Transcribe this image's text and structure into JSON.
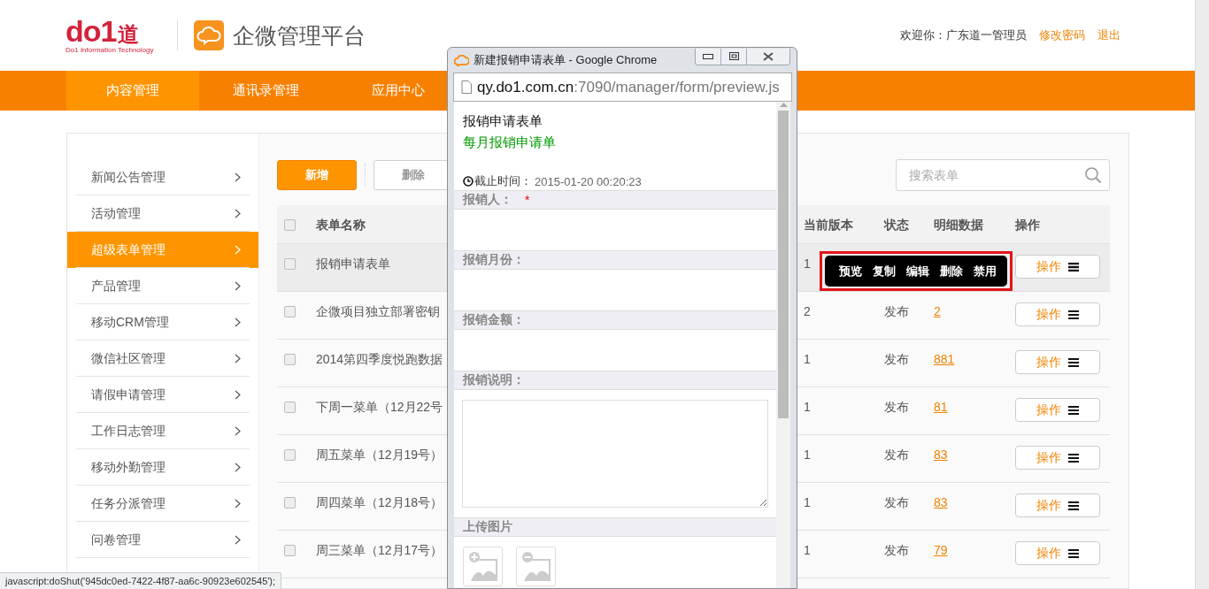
{
  "header": {
    "logo": {
      "mark": "do1",
      "char": "道",
      "tagline": "Do1 Information Technology"
    },
    "product": "企微管理平台",
    "welcome": "欢迎你：广东道一管理员",
    "links": [
      "修改密码",
      "退出"
    ]
  },
  "nav": {
    "tabs": [
      {
        "label": "内容管理",
        "selected": true
      },
      {
        "label": "通讯录管理",
        "selected": false
      },
      {
        "label": "应用中心",
        "selected": false
      }
    ]
  },
  "sidebar": {
    "items": [
      {
        "label": "新闻公告管理",
        "selected": false
      },
      {
        "label": "活动管理",
        "selected": false
      },
      {
        "label": "超级表单管理",
        "selected": true
      },
      {
        "label": "产品管理",
        "selected": false
      },
      {
        "label": "移动CRM管理",
        "selected": false
      },
      {
        "label": "微信社区管理",
        "selected": false
      },
      {
        "label": "请假申请管理",
        "selected": false
      },
      {
        "label": "工作日志管理",
        "selected": false
      },
      {
        "label": "移动外勤管理",
        "selected": false
      },
      {
        "label": "任务分派管理",
        "selected": false
      },
      {
        "label": "问卷管理",
        "selected": false
      }
    ]
  },
  "toolbar": {
    "buttons": [
      {
        "label": "新增",
        "kind": "primary"
      },
      {
        "label": "删除",
        "kind": "default"
      }
    ],
    "search": {
      "placeholder": "搜索表单"
    }
  },
  "table": {
    "select_all_checked": false,
    "columns": [
      "表单名称",
      "当前版本",
      "状态",
      "明细数据",
      "操作"
    ],
    "rows": [
      {
        "checked": false,
        "hovered": true,
        "name": "报销申请表单",
        "version": "1",
        "action": "操作"
      },
      {
        "checked": false,
        "hovered": false,
        "name": "企微项目独立部署密钥",
        "version": "2",
        "status": "发布",
        "detail": "2",
        "action": "操作"
      },
      {
        "checked": false,
        "hovered": false,
        "name": "2014第四季度悦跑数据",
        "version": "1",
        "status": "发布",
        "detail": "881",
        "action": "操作"
      },
      {
        "checked": false,
        "hovered": false,
        "name": "下周一菜单（12月22号",
        "version": "1",
        "status": "发布",
        "detail": "81",
        "action": "操作"
      },
      {
        "checked": false,
        "hovered": false,
        "name": "周五菜单（12月19号）",
        "version": "1",
        "status": "发布",
        "detail": "83",
        "action": "操作"
      },
      {
        "checked": false,
        "hovered": false,
        "name": "周四菜单（12月18号）",
        "version": "1",
        "status": "发布",
        "detail": "83",
        "action": "操作"
      },
      {
        "checked": false,
        "hovered": false,
        "name": "周三菜单（12月17号）",
        "version": "1",
        "status": "发布",
        "detail": "79",
        "action": "操作"
      }
    ]
  },
  "action_menu": {
    "items": [
      "预览",
      "复制",
      "编辑",
      "删除",
      "禁用"
    ]
  },
  "popup_window": {
    "title": "新建报销申请表单 - Google Chrome",
    "url_host": "qy.do1.com.cn",
    "url_path": ":7090/manager/form/preview.js",
    "form": {
      "title": "报销申请表单",
      "subtitle": "每月报销申请单",
      "deadline_label": "截止时间：",
      "deadline": "2015-01-20 00:20:23",
      "fields": [
        {
          "label": "报销人：",
          "required_mark": "*",
          "kind": "text"
        },
        {
          "label": "报销月份：",
          "kind": "text"
        },
        {
          "label": "报销金额：",
          "kind": "text"
        },
        {
          "label": "报销说明：",
          "kind": "textarea"
        },
        {
          "label": "上传图片",
          "kind": "images"
        }
      ]
    }
  },
  "status_bar": {
    "text": "javascript:doShut('945dc0ed-7422-4f87-aa6c-90923e602545');"
  }
}
